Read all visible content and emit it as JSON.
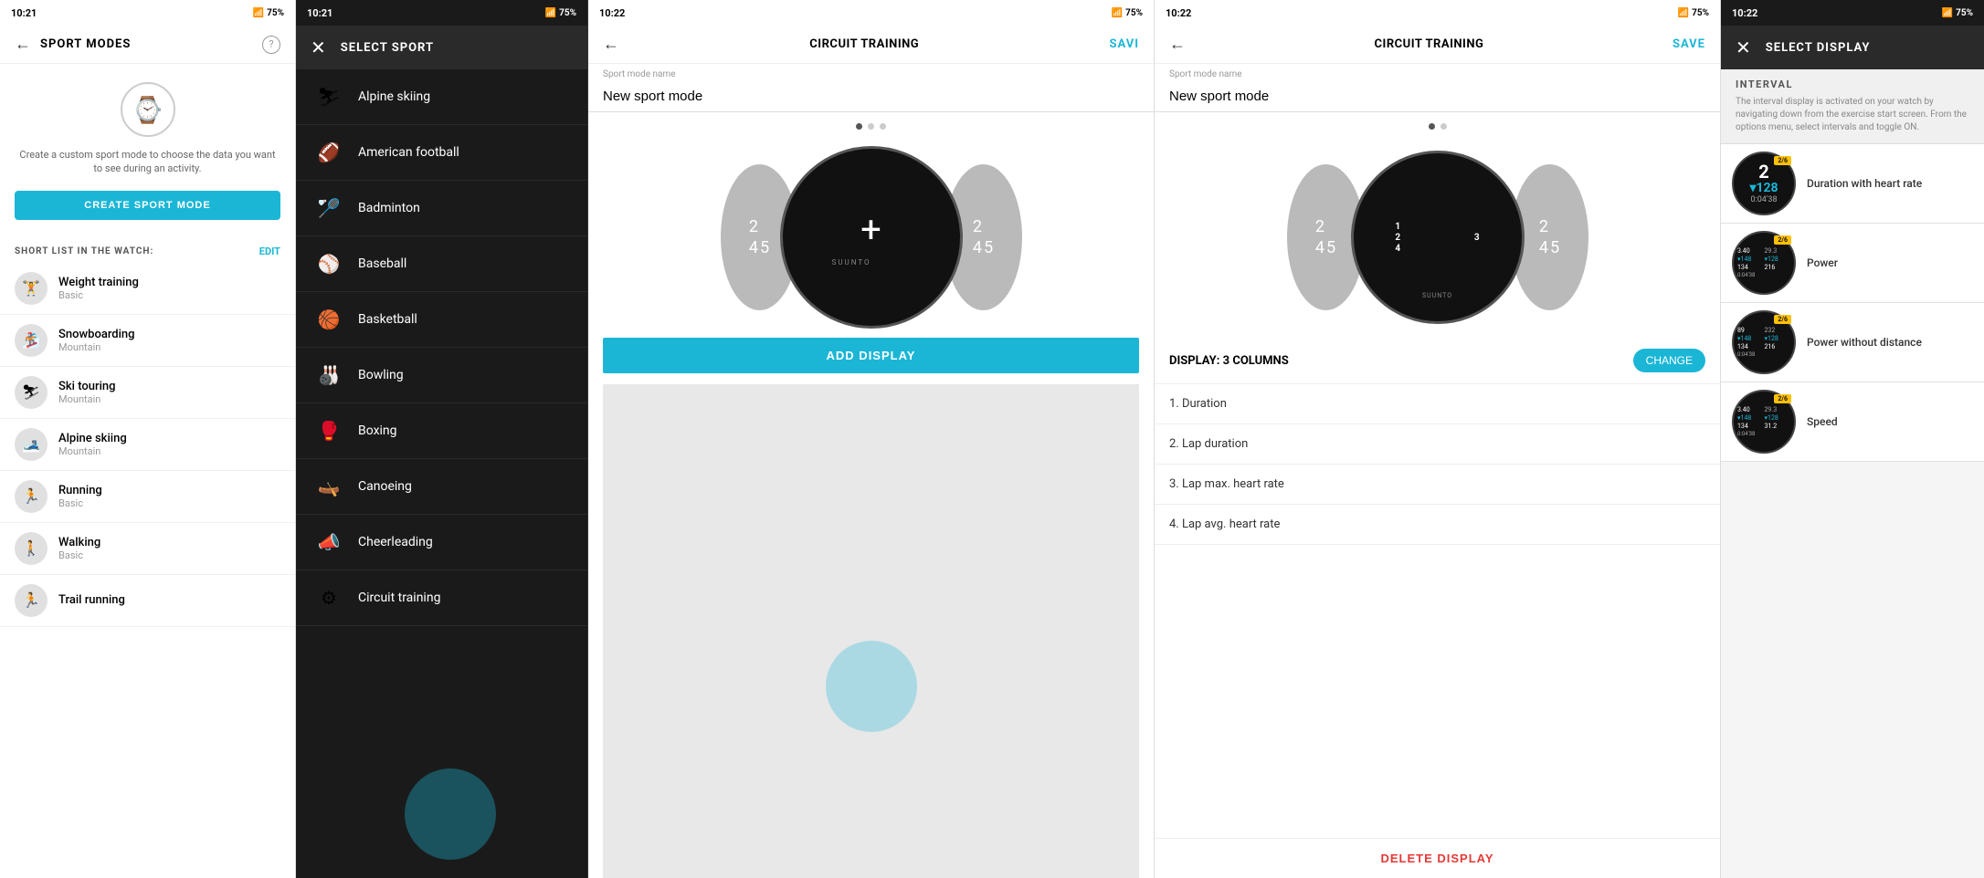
{
  "panel1": {
    "statusBar": {
      "time": "10:21",
      "battery": "75%"
    },
    "header": {
      "title": "SPORT MODES",
      "backLabel": "←",
      "helpLabel": "?"
    },
    "watchDesc": "Create a custom sport mode to choose the data you want to see during an activity.",
    "createBtn": "CREATE SPORT MODE",
    "shortListLabel": "SHORT LIST IN THE WATCH:",
    "editLabel": "EDIT",
    "sportItems": [
      {
        "name": "Weight training",
        "sub": "Basic",
        "icon": "🏋"
      },
      {
        "name": "Snowboarding",
        "sub": "Mountain",
        "icon": "🏂"
      },
      {
        "name": "Ski touring",
        "sub": "Mountain",
        "icon": "⛷"
      },
      {
        "name": "Alpine skiing",
        "sub": "Mountain",
        "icon": "🎿"
      },
      {
        "name": "Running",
        "sub": "Basic",
        "icon": "🏃"
      },
      {
        "name": "Walking",
        "sub": "Basic",
        "icon": "🚶"
      },
      {
        "name": "Trail running",
        "sub": "",
        "icon": "🏃"
      }
    ]
  },
  "panel2": {
    "statusBar": {
      "time": "10:21",
      "battery": "75%"
    },
    "header": {
      "title": "SELECT SPORT"
    },
    "sports": [
      {
        "name": "Alpine skiing",
        "icon": "⛷"
      },
      {
        "name": "American football",
        "icon": "🏈"
      },
      {
        "name": "Badminton",
        "icon": "🏸"
      },
      {
        "name": "Baseball",
        "icon": "⚾"
      },
      {
        "name": "Basketball",
        "icon": "🏀"
      },
      {
        "name": "Bowling",
        "icon": "🎳"
      },
      {
        "name": "Boxing",
        "icon": "🥊"
      },
      {
        "name": "Canoeing",
        "icon": "🛶"
      },
      {
        "name": "Cheerleading",
        "icon": "📣"
      },
      {
        "name": "Circuit training",
        "icon": "⚙"
      }
    ]
  },
  "panel3": {
    "statusBar": {
      "time": "10:22",
      "battery": "75%"
    },
    "header": {
      "title": "CIRCUIT TRAINING",
      "saveLabel": "SAVI"
    },
    "sportModeLabel": "Sport mode name",
    "sportModeName": "New sport mode",
    "addDisplayBtn": "ADD DISPLAY"
  },
  "panel4": {
    "statusBar": {
      "time": "10:22",
      "battery": "75%"
    },
    "header": {
      "title": "CIRCUIT TRAINING",
      "saveLabel": "SAVE"
    },
    "sportModeLabel": "Sport mode name",
    "sportModeName": "New sport mode",
    "displayLabel": "DISPLAY: 3 COLUMNS",
    "changeBtn": "CHANGE",
    "displayItems": [
      "1. Duration",
      "2. Lap duration",
      "3. Lap max. heart rate",
      "4. Lap avg. heart rate"
    ],
    "deleteBtn": "DELETE DISPLAY"
  },
  "panel5": {
    "statusBar": {
      "time": "10:22",
      "battery": "75%"
    },
    "header": {
      "title": "SELECT DISPLAY"
    },
    "intervalLabel": "INTERVAL",
    "intervalDesc": "The interval display is activated on your watch by navigating down from the exercise start screen. From the options menu, select intervals and toggle ON.",
    "displayOptions": [
      {
        "name": "Duration with heart rate",
        "badge": "2/6",
        "big": "2",
        "hr": "▾128",
        "time": "0:04'38"
      },
      {
        "name": "Power",
        "badge": "2/6"
      },
      {
        "name": "Power without distance",
        "badge": "2/6"
      },
      {
        "name": "Speed",
        "badge": "2/6"
      }
    ]
  }
}
